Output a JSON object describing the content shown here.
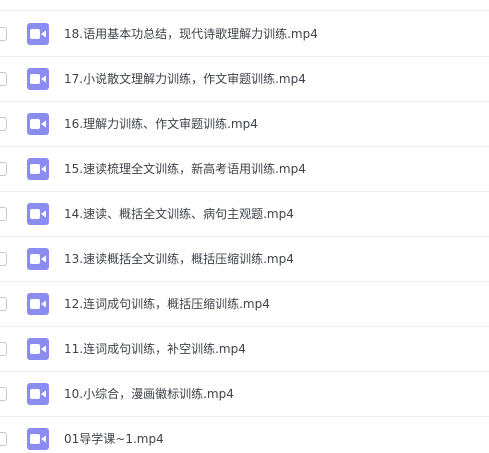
{
  "file_list": {
    "icon": "video-file-icon",
    "icon_color": "#8a8cf0",
    "items": [
      {
        "name": "18.语用基本功总结，现代诗歌理解力训练.mp4"
      },
      {
        "name": "17.小说散文理解力训练，作文审题训练.mp4"
      },
      {
        "name": "16.理解力训练、作文审题训练.mp4"
      },
      {
        "name": "15.速读梳理全文训练，新高考语用训练.mp4"
      },
      {
        "name": "14.速读、概括全文训练、病句主观题.mp4"
      },
      {
        "name": "13.速读概括全文训练，概括压缩训练.mp4"
      },
      {
        "name": "12.连词成句训练，概括压缩训练.mp4"
      },
      {
        "name": "11.连词成句训练，补空训练.mp4"
      },
      {
        "name": "10.小综合，漫画徽标训练.mp4"
      },
      {
        "name": "01导学课~1.mp4"
      }
    ]
  }
}
